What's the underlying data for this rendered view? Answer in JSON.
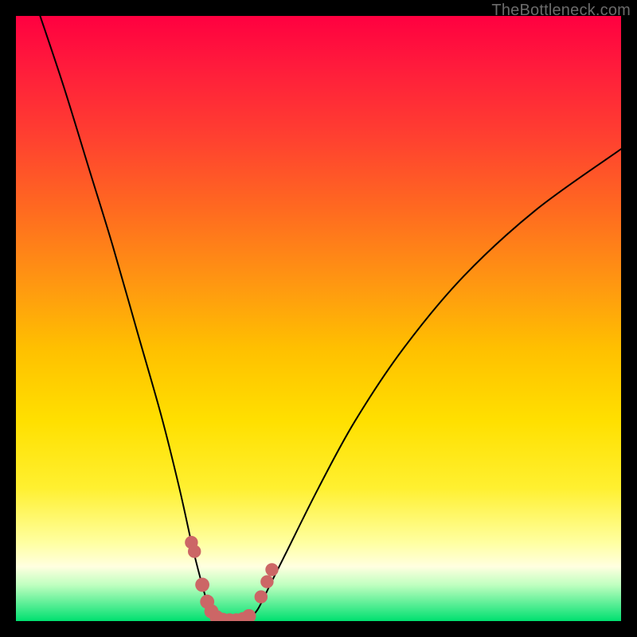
{
  "attribution": "TheBottleneck.com",
  "colors": {
    "frame": "#000000",
    "curve": "#000000",
    "markers_fill": "#cc6666",
    "markers_stroke": "#a04040",
    "gradient_top": "#ff0040",
    "gradient_bottom": "#00e070"
  },
  "chart_data": {
    "type": "line",
    "title": "",
    "xlabel": "",
    "ylabel": "",
    "xlim": [
      0,
      100
    ],
    "ylim": [
      0,
      100
    ],
    "grid": false,
    "legend": false,
    "series": [
      {
        "name": "left-curve",
        "x": [
          4,
          8,
          12,
          16,
          20,
          24,
          27,
          29,
          30.5,
          31.5,
          32.5,
          33.3
        ],
        "y": [
          100,
          88,
          75,
          62,
          48,
          34,
          22,
          13,
          7,
          3.5,
          1.5,
          0.3
        ]
      },
      {
        "name": "right-curve",
        "x": [
          38.5,
          40,
          42,
          45,
          50,
          56,
          64,
          74,
          86,
          100
        ],
        "y": [
          0.3,
          2,
          6,
          12,
          22,
          33,
          45,
          57,
          68,
          78
        ]
      },
      {
        "name": "valley-floor",
        "x": [
          33.3,
          34.5,
          36,
          37.4,
          38.5
        ],
        "y": [
          0.3,
          0.0,
          0.0,
          0.0,
          0.3
        ]
      }
    ],
    "markers": [
      {
        "x": 29.0,
        "y": 13.0,
        "r": 1.2
      },
      {
        "x": 29.5,
        "y": 11.5,
        "r": 1.2
      },
      {
        "x": 30.8,
        "y": 6.0,
        "r": 1.3
      },
      {
        "x": 31.6,
        "y": 3.2,
        "r": 1.3
      },
      {
        "x": 32.3,
        "y": 1.6,
        "r": 1.3
      },
      {
        "x": 33.2,
        "y": 0.6,
        "r": 1.3
      },
      {
        "x": 34.2,
        "y": 0.2,
        "r": 1.3
      },
      {
        "x": 35.3,
        "y": 0.1,
        "r": 1.3
      },
      {
        "x": 36.4,
        "y": 0.1,
        "r": 1.3
      },
      {
        "x": 37.5,
        "y": 0.3,
        "r": 1.3
      },
      {
        "x": 38.5,
        "y": 0.8,
        "r": 1.3
      },
      {
        "x": 40.5,
        "y": 4.0,
        "r": 1.2
      },
      {
        "x": 41.5,
        "y": 6.5,
        "r": 1.2
      },
      {
        "x": 42.3,
        "y": 8.5,
        "r": 1.2
      }
    ]
  }
}
